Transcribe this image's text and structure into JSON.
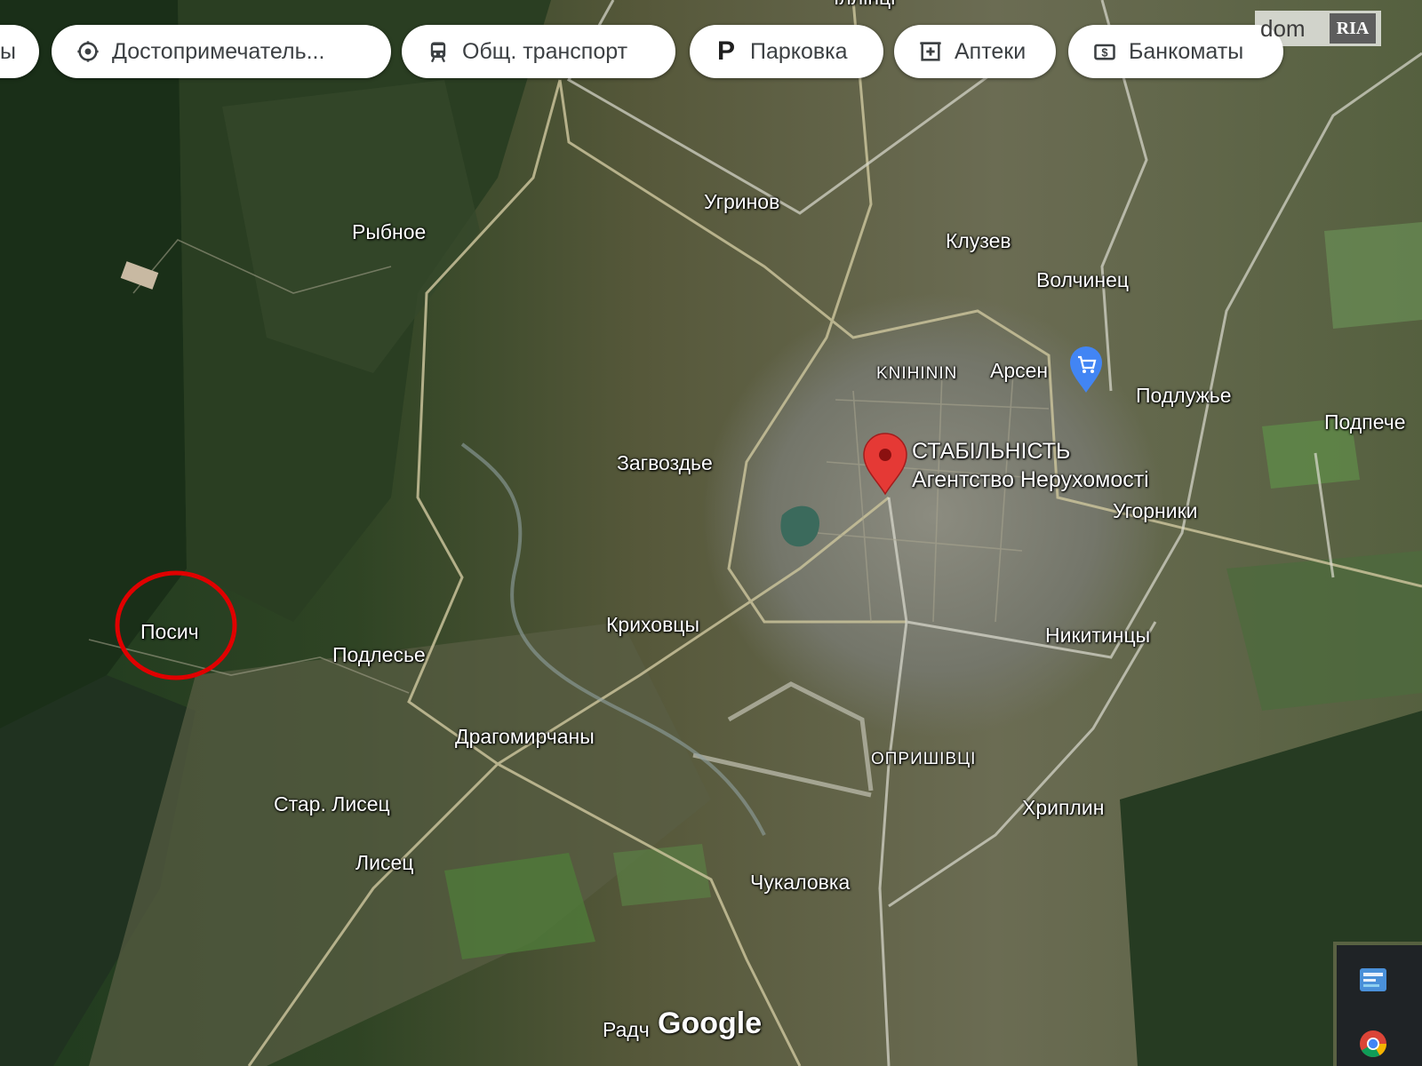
{
  "filter_chips": [
    {
      "label": "ы",
      "icon": "none"
    },
    {
      "label": "Достопримечатель...",
      "icon": "landmark-icon"
    },
    {
      "label": "Общ. транспорт",
      "icon": "transit-icon"
    },
    {
      "label": "Парковка",
      "icon": "parking-icon"
    },
    {
      "label": "Аптеки",
      "icon": "pharmacy-icon"
    },
    {
      "label": "Банкоматы",
      "icon": "atm-icon"
    }
  ],
  "watermark": {
    "left": "dom",
    "right": "RIA"
  },
  "places": {
    "top_cut": "Іллінці",
    "ugrinov": "Угринов",
    "rybnoe": "Рыбное",
    "kluzev": "Клузев",
    "volchinets": "Волчинец",
    "knihinin": "KNIHININ",
    "arsen": "Арсен",
    "podluzhye": "Подлужье",
    "podpeche": "Подпече",
    "zagvozdye": "Загвоздье",
    "ugorniki": "Угорники",
    "posich": "Посич",
    "podlesye": "Подлесье",
    "krikhovtsy": "Криховцы",
    "nikitintsy": "Никитинцы",
    "dragomirchany": "Драгомирчаны",
    "oprishivtsi": "ОПРИШІВЦІ",
    "star_lisets": "Стар. Лисец",
    "khriplin": "Хриплин",
    "lisets": "Лисец",
    "chukalovka": "Чукаловка",
    "radch": "Радч"
  },
  "marker": {
    "title": "СТАБІЛЬНІСТЬ",
    "subtitle": "Агентство Нерухомості",
    "color": "#e53935"
  },
  "highlight_circle": {
    "color": "#e00000",
    "target": "Посич"
  },
  "google_logo": "Google",
  "taskbar_icons": [
    "app-icon",
    "chrome-icon"
  ]
}
